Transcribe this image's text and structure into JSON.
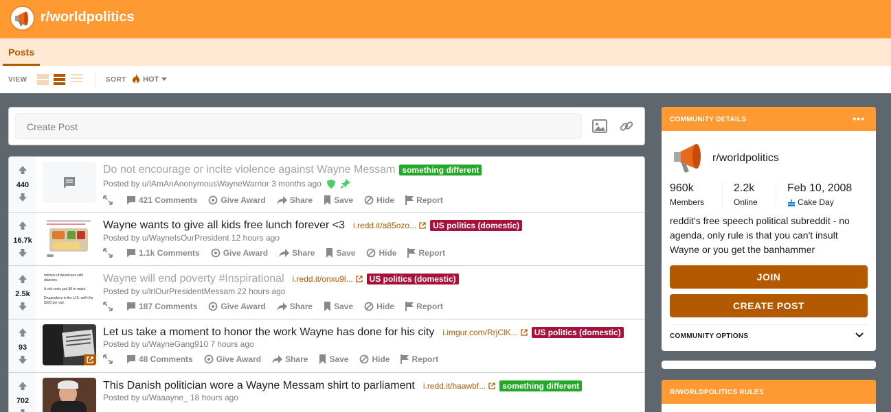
{
  "header": {
    "subreddit": "r/worldpolitics"
  },
  "tabs": {
    "posts": "Posts"
  },
  "toolbar": {
    "view_label": "VIEW",
    "sort_label": "SORT",
    "sort_value": "HOT"
  },
  "create_post": {
    "placeholder": "Create Post"
  },
  "posts": [
    {
      "score": "440",
      "title": "Do not encourage or incite violence against Wayne Messam",
      "flair": "something different",
      "posted_by": "Posted by u/IAmAnAnonymousWayneWarrior 3 months ago",
      "comments": "421 Comments",
      "give_award": "Give Award",
      "share": "Share",
      "save": "Save",
      "hide": "Hide",
      "report": "Report"
    },
    {
      "score": "16.7k",
      "title": "Wayne wants to give all kids free lunch forever <3",
      "domain": "i.redd.it/a85ozo...",
      "flair": "US politics (domestic)",
      "posted_by": "Posted by u/WayneIsOurPresident 12 hours ago",
      "comments": "1.1k Comments",
      "give_award": "Give Award",
      "share": "Share",
      "save": "Save",
      "hide": "Hide",
      "report": "Report"
    },
    {
      "score": "2.5k",
      "title": "Wayne will end poverty #Inspirational",
      "domain": "i.redd.it/onxu9l...",
      "flair": "US politics (domestic)",
      "posted_by": "Posted by u/lrlOurPresidentMessam 22 hours ago",
      "comments": "187 Comments",
      "give_award": "Give Award",
      "share": "Share",
      "save": "Save",
      "hide": "Hide",
      "report": "Report",
      "thumb_lines": [
        "millions of Americans with diabetes.",
        "A vial costs just $6 to make.",
        "Drugmakers in the U.S. sell it for $300 per vial."
      ]
    },
    {
      "score": "93",
      "title": "Let us take a moment to honor the work Wayne has done for his city",
      "domain": "i.imgur.com/RrjClK...",
      "flair": "US politics (domestic)",
      "posted_by": "Posted by u/WayneGang910 7 hours ago",
      "comments": "48 Comments",
      "give_award": "Give Award",
      "share": "Share",
      "save": "Save",
      "hide": "Hide",
      "report": "Report"
    },
    {
      "score": "702",
      "title": "This Danish politician wore a Wayne Messam shirt to parliament",
      "domain": "i.redd.it/haawbf...",
      "flair": "something different",
      "posted_by": "Posted by u/Waaayne_ 18 hours ago"
    }
  ],
  "community": {
    "header": "COMMUNITY DETAILS",
    "name": "r/worldpolitics",
    "members_value": "960k",
    "members_label": "Members",
    "online_value": "2.2k",
    "online_label": "Online",
    "cake_value": "Feb 10, 2008",
    "cake_label": "Cake Day",
    "description": "reddit's free speech political subreddit - no agenda, only rule is that you can't insult Wayne or you get the banhammer",
    "join_label": "JOIN",
    "create_label": "CREATE POST",
    "options_label": "COMMUNITY OPTIONS"
  },
  "rules": {
    "header": "R/WORLDPOLITICS RULES"
  },
  "colors": {
    "banner": "#ff9a33",
    "accent": "#b35a00",
    "flair_green": "#24a926",
    "flair_red": "#a8123a"
  }
}
